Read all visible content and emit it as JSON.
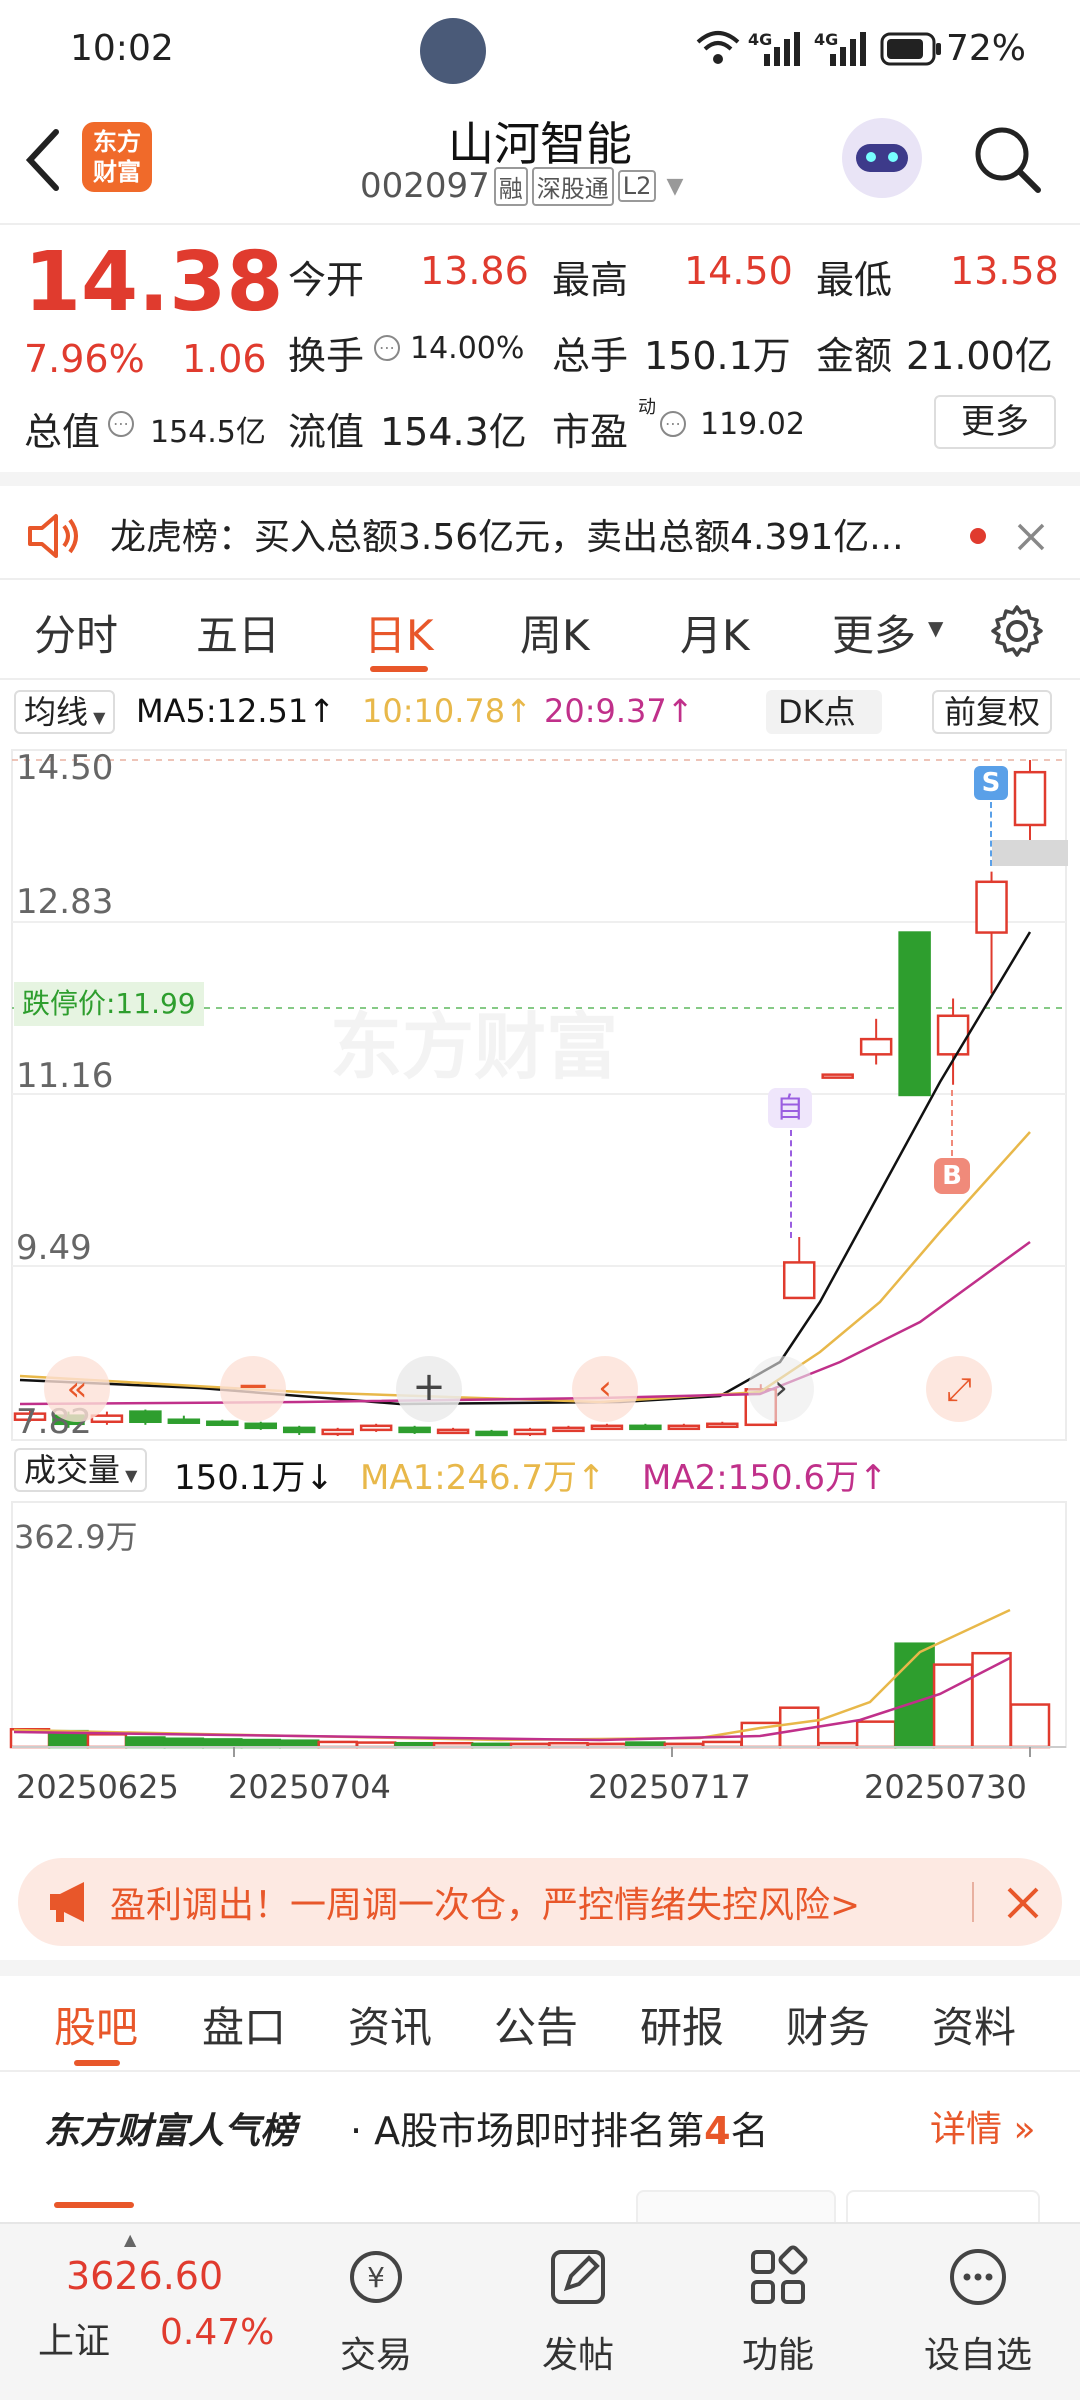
{
  "status_bar": {
    "time": "10:02",
    "network1": "4G",
    "network2": "4G",
    "battery": "72%"
  },
  "header": {
    "logo_line1": "东方",
    "logo_line2": "财富",
    "title": "山河智能",
    "code": "002097",
    "badges": [
      "融",
      "深股通",
      "L2"
    ]
  },
  "quote": {
    "price": "14.38",
    "change_pct": "7.96%",
    "change": "1.06",
    "open_label": "今开",
    "open": "13.86",
    "high_label": "最高",
    "high": "14.50",
    "low_label": "最低",
    "low": "13.58",
    "turnover_label": "换手",
    "turnover": "14.00%",
    "volume_label": "总手",
    "volume": "150.1万",
    "amount_label": "金额",
    "amount": "21.00亿",
    "mktcap_label": "总值",
    "mktcap": "154.5亿",
    "float_label": "流值",
    "float": "154.3亿",
    "pe_label": "市盈",
    "pe_sup": "动",
    "pe": "119.02",
    "more": "更多"
  },
  "notice": {
    "text": "龙虎榜：买入总额3.56亿元，卖出总额4.391亿..."
  },
  "tabs": [
    "分时",
    "五日",
    "日K",
    "周K",
    "月K",
    "更多"
  ],
  "active_tab": 2,
  "ma_bar": {
    "ma_select": "均线",
    "ma5": "MA5:12.51↑",
    "ma10": "10:10.78↑",
    "ma20": "20:9.37↑",
    "dk": "DK点",
    "adjust": "前复权"
  },
  "kline_axis": {
    "y1": "14.50",
    "y2": "12.83",
    "y3": "11.16",
    "y4": "9.49",
    "y5": "7.82"
  },
  "limit_down_label": "跌停价:11.99",
  "watermark": "东方财富",
  "markers": {
    "sell": "S",
    "buy": "B",
    "self": "自"
  },
  "vol_bar": {
    "select": "成交量",
    "vol": "150.1万↓",
    "ma1": "MA1:246.7万↑",
    "ma2": "MA2:150.6万↑",
    "max": "362.9万"
  },
  "dates": [
    "20250625",
    "20250704",
    "20250717",
    "20250730"
  ],
  "banner": {
    "text": "盈利调出！一周调一次仓，严控情绪失控风险>"
  },
  "subtabs": [
    "股吧",
    "盘口",
    "资讯",
    "公告",
    "研报",
    "财务",
    "资料"
  ],
  "active_subtab": 0,
  "popularity": {
    "brand": "东方财富人气榜",
    "text_pre": "· A股市场即时排名第",
    "rank": "4",
    "text_post": "名",
    "detail": "详情"
  },
  "bottom": {
    "index_value": "3626.60",
    "index_name": "上证",
    "index_pct": "0.47%",
    "items": [
      "交易",
      "发帖",
      "功能",
      "设自选"
    ]
  },
  "colors": {
    "up": "#e03b2e",
    "down": "#2e9e2e",
    "ma5": "#111111",
    "ma10": "#e8b84a",
    "ma20": "#c0308a",
    "accent": "#e8572a"
  }
}
